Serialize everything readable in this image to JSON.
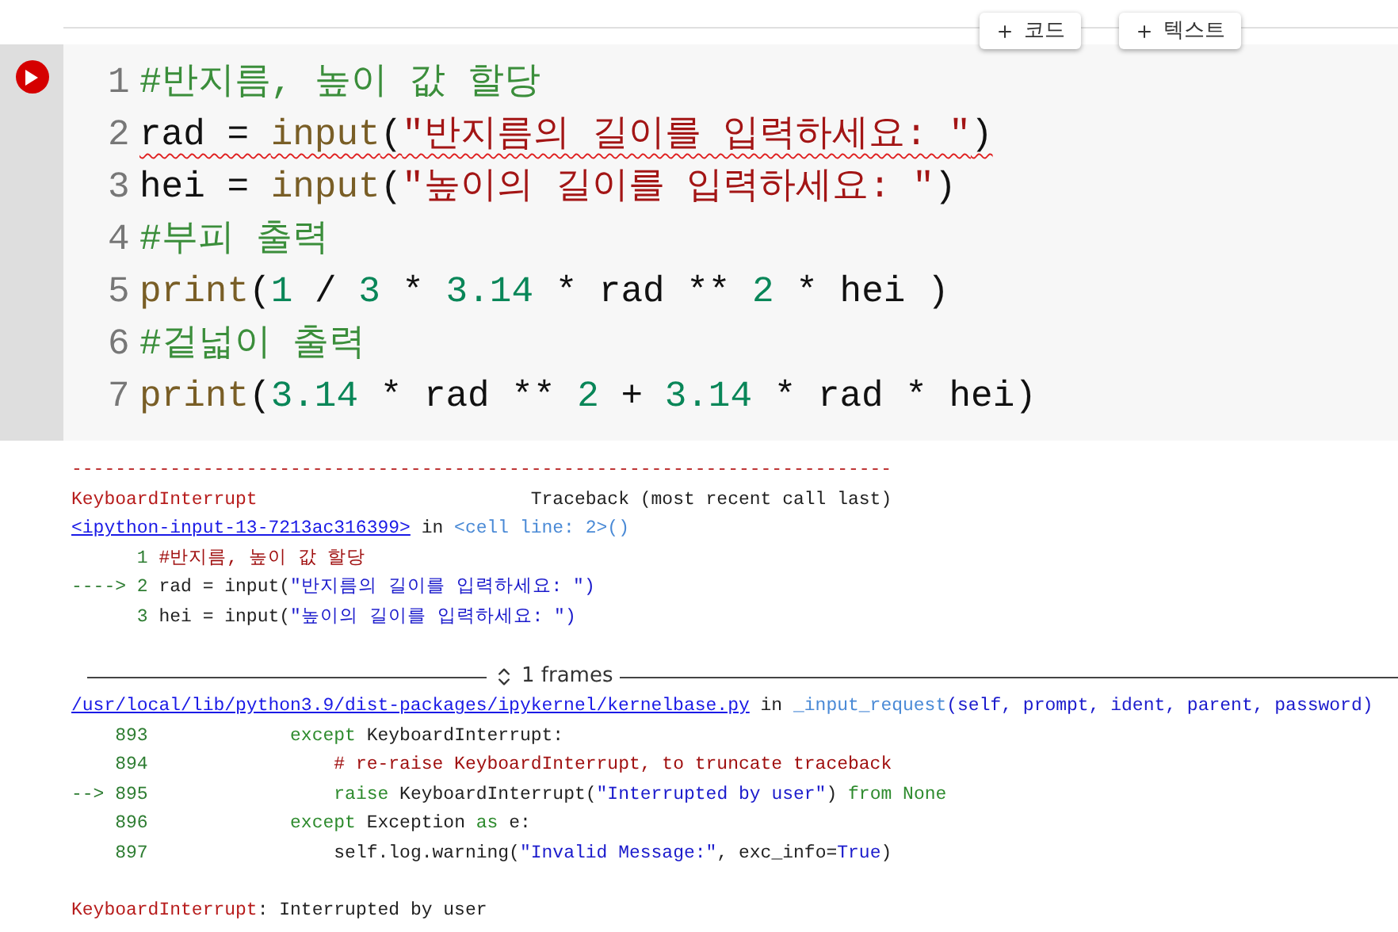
{
  "toolbar": {
    "buttons": [
      {
        "label": "코드"
      },
      {
        "label": "텍스트"
      }
    ]
  },
  "cell": {
    "lines": [
      {
        "number": "1",
        "squiggle": false,
        "tokens": [
          {
            "t": "#반지름, 높이 값 할당",
            "kind": "comment"
          }
        ]
      },
      {
        "number": "2",
        "squiggle": true,
        "tokens": [
          {
            "t": "rad = ",
            "kind": "plain"
          },
          {
            "t": "input",
            "kind": "func"
          },
          {
            "t": "(",
            "kind": "plain"
          },
          {
            "t": "\"반지름의 길이를 입력하세요: \"",
            "kind": "string"
          },
          {
            "t": ")",
            "kind": "plain"
          }
        ]
      },
      {
        "number": "3",
        "squiggle": false,
        "tokens": [
          {
            "t": "hei = ",
            "kind": "plain"
          },
          {
            "t": "input",
            "kind": "func"
          },
          {
            "t": "(",
            "kind": "plain"
          },
          {
            "t": "\"높이의 길이를 입력하세요: \"",
            "kind": "string"
          },
          {
            "t": ")",
            "kind": "plain"
          }
        ]
      },
      {
        "number": "4",
        "squiggle": false,
        "tokens": [
          {
            "t": "#부피 출력",
            "kind": "comment"
          }
        ]
      },
      {
        "number": "5",
        "squiggle": false,
        "tokens": [
          {
            "t": "print",
            "kind": "func"
          },
          {
            "t": "(",
            "kind": "plain"
          },
          {
            "t": "1",
            "kind": "number"
          },
          {
            "t": " / ",
            "kind": "plain"
          },
          {
            "t": "3",
            "kind": "number"
          },
          {
            "t": " * ",
            "kind": "plain"
          },
          {
            "t": "3.14",
            "kind": "number"
          },
          {
            "t": " * rad ** ",
            "kind": "plain"
          },
          {
            "t": "2",
            "kind": "number"
          },
          {
            "t": " * hei )",
            "kind": "plain"
          }
        ]
      },
      {
        "number": "6",
        "squiggle": false,
        "tokens": [
          {
            "t": "#겉넓이 출력",
            "kind": "comment"
          }
        ]
      },
      {
        "number": "7",
        "squiggle": false,
        "tokens": [
          {
            "t": "print",
            "kind": "func"
          },
          {
            "t": "(",
            "kind": "plain"
          },
          {
            "t": "3.14",
            "kind": "number"
          },
          {
            "t": " * rad ** ",
            "kind": "plain"
          },
          {
            "t": "2",
            "kind": "number"
          },
          {
            "t": " + ",
            "kind": "plain"
          },
          {
            "t": "3.14",
            "kind": "number"
          },
          {
            "t": " * rad * hei)",
            "kind": "plain"
          }
        ]
      }
    ]
  },
  "output": {
    "lines": [
      {
        "tokens": [
          {
            "t": "---------------------------------------------------------------------------",
            "kind": "error"
          }
        ]
      },
      {
        "tokens": [
          {
            "t": "KeyboardInterrupt                         ",
            "kind": "error"
          },
          {
            "t": "Traceback (most recent call last)",
            "kind": "plain"
          }
        ]
      },
      {
        "tokens": [
          {
            "t": "<ipython-input-13-7213ac316399>",
            "kind": "link"
          },
          {
            "t": " in ",
            "kind": "plain"
          },
          {
            "t": "<cell line: 2>",
            "kind": "ref"
          },
          {
            "t": "()",
            "kind": "ref"
          }
        ]
      },
      {
        "tokens": [
          {
            "t": "      1 ",
            "kind": "lineno"
          },
          {
            "t": "#반지름, 높이 값 할당",
            "kind": "comment"
          }
        ]
      },
      {
        "tokens": [
          {
            "t": "----> 2 ",
            "kind": "lineno"
          },
          {
            "t": "rad = input(",
            "kind": "plain"
          },
          {
            "t": "\"반지름의 길이를 입력하세요: \")",
            "kind": "string"
          }
        ]
      },
      {
        "tokens": [
          {
            "t": "      3 ",
            "kind": "lineno"
          },
          {
            "t": "hei = input(",
            "kind": "plain"
          },
          {
            "t": "\"높이의 길이를 입력하세요: \")",
            "kind": "string"
          }
        ]
      }
    ],
    "frames": {
      "label": "1 frames",
      "expanded": false
    },
    "lines2": [
      {
        "tokens": [
          {
            "t": "/usr/local/lib/python3.9/dist-packages/ipykernel/kernelbase.py",
            "kind": "link"
          },
          {
            "t": " in ",
            "kind": "plain"
          },
          {
            "t": "_input_request",
            "kind": "ref"
          },
          {
            "t": "(self, prompt, ident, parent, password)",
            "kind": "string"
          }
        ]
      },
      {
        "tokens": [
          {
            "t": "    893             ",
            "kind": "lineno"
          },
          {
            "t": "except",
            "kind": "keyword"
          },
          {
            "t": " KeyboardInterrupt:",
            "kind": "plain"
          }
        ]
      },
      {
        "tokens": [
          {
            "t": "    894                 ",
            "kind": "lineno"
          },
          {
            "t": "# re-raise KeyboardInterrupt, to truncate traceback",
            "kind": "comment"
          }
        ]
      },
      {
        "tokens": [
          {
            "t": "--> 895                 ",
            "kind": "lineno"
          },
          {
            "t": "raise",
            "kind": "keyword"
          },
          {
            "t": " KeyboardInterrupt(",
            "kind": "plain"
          },
          {
            "t": "\"Interrupted by user\"",
            "kind": "string"
          },
          {
            "t": ") ",
            "kind": "plain"
          },
          {
            "t": "from None",
            "kind": "keyword"
          }
        ]
      },
      {
        "tokens": [
          {
            "t": "    896             ",
            "kind": "lineno"
          },
          {
            "t": "except",
            "kind": "keyword"
          },
          {
            "t": " Exception ",
            "kind": "plain"
          },
          {
            "t": "as",
            "kind": "keyword"
          },
          {
            "t": " e:",
            "kind": "plain"
          }
        ]
      },
      {
        "tokens": [
          {
            "t": "    897                 ",
            "kind": "lineno"
          },
          {
            "t": "self.log.warning(",
            "kind": "plain"
          },
          {
            "t": "\"Invalid Message:\"",
            "kind": "string"
          },
          {
            "t": ", exc_info=",
            "kind": "plain"
          },
          {
            "t": "True",
            "kind": "string"
          },
          {
            "t": ")",
            "kind": "plain"
          }
        ]
      }
    ],
    "summary": {
      "tokens": [
        {
          "t": "KeyboardInterrupt",
          "kind": "error"
        },
        {
          "t": ": Interrupted by user",
          "kind": "plain"
        }
      ]
    }
  }
}
